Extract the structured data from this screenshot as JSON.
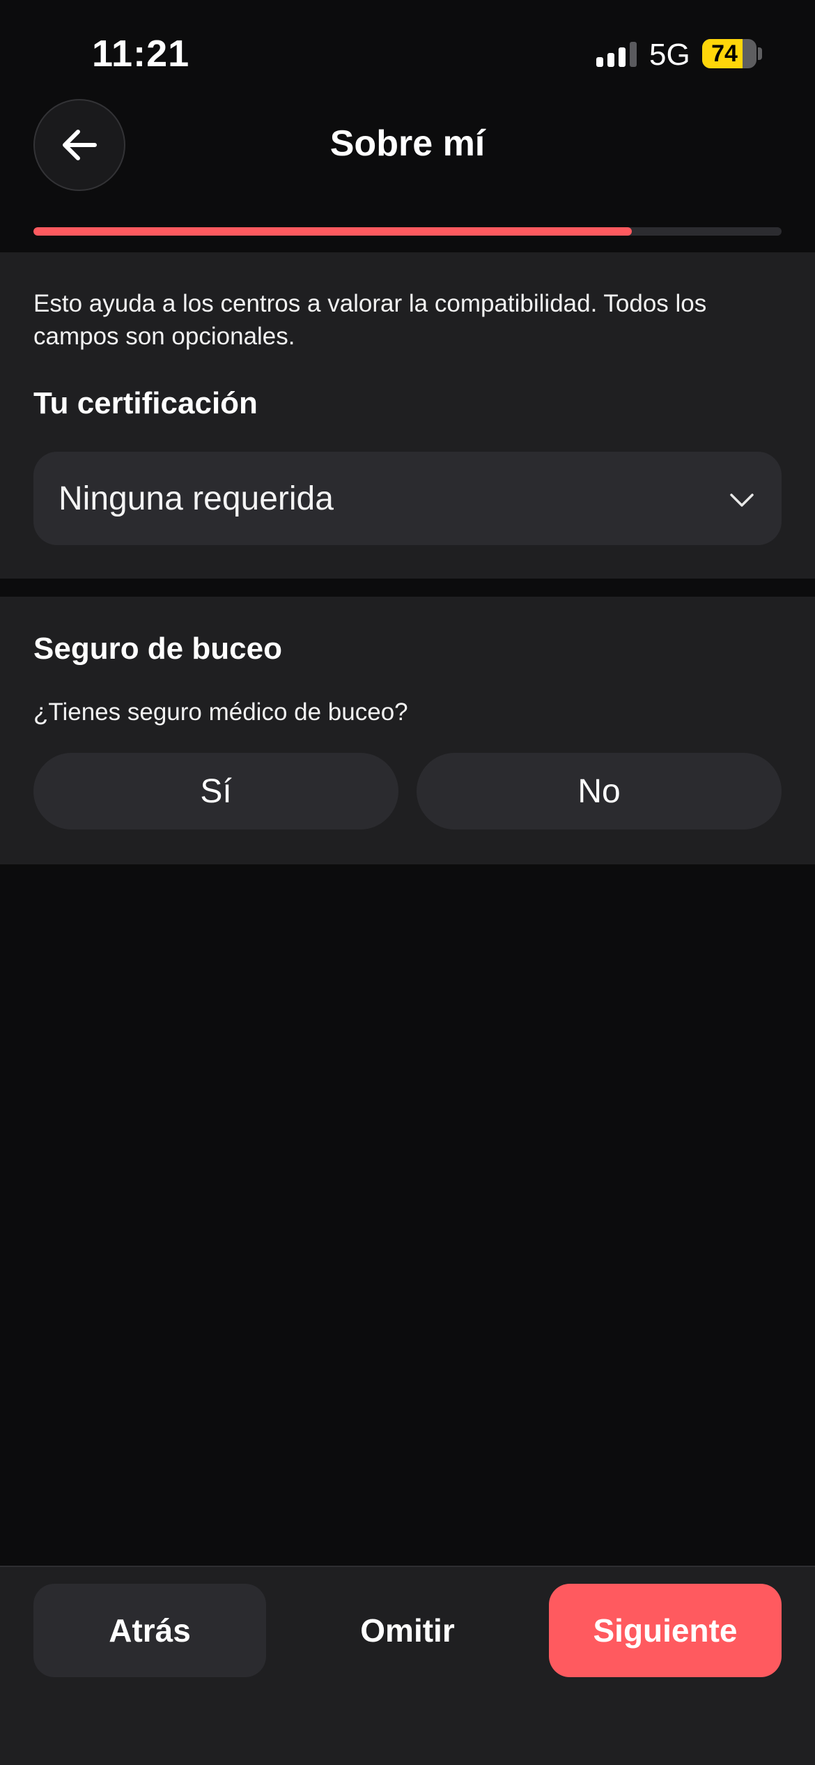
{
  "status_bar": {
    "time": "11:21",
    "network": "5G",
    "battery_level": "74",
    "battery_percent": 74,
    "signal_bars_active": 3,
    "signal_bars_total": 4
  },
  "header": {
    "back_icon": "arrow-left-icon",
    "title": "Sobre mí"
  },
  "progress": {
    "fraction": 0.8
  },
  "about": {
    "intro": "Esto ayuda a los centros a valorar la compatibilidad. Todos los campos son opcionales.",
    "certification_title": "Tu certificación",
    "certification_value": "Ninguna requerida",
    "chevron_icon": "chevron-down-icon"
  },
  "insurance": {
    "title": "Seguro de buceo",
    "question": "¿Tienes seguro médico de buceo?",
    "yes_label": "Sí",
    "no_label": "No"
  },
  "footer": {
    "back_label": "Atrás",
    "skip_label": "Omitir",
    "next_label": "Siguiente"
  },
  "colors": {
    "accent": "#ff5a5f",
    "battery": "#ffd60a",
    "surface": "#1f1f21",
    "background": "#0c0c0d"
  }
}
